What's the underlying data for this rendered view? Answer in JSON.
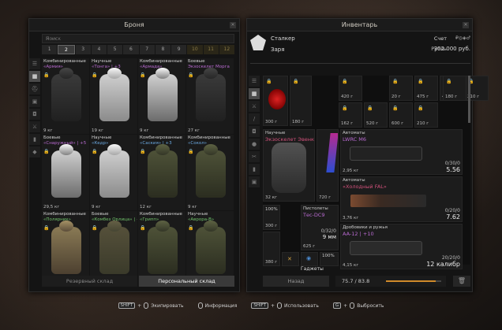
{
  "left_panel": {
    "title": "Броня",
    "search_placeholder": "Поиск",
    "search_controls": "✕  ‹  ›",
    "pages": [
      "1",
      "2",
      "3",
      "4",
      "5",
      "6",
      "7",
      "8",
      "9",
      "10",
      "11",
      "12"
    ],
    "active_page": "2",
    "sidebar_icons": [
      "list-icon",
      "grid-icon",
      "helmet-icon",
      "backpack-icon",
      "armor-icon",
      "weapon-icon",
      "ammo-icon",
      "artifact-icon"
    ],
    "items": [
      {
        "type": "Комбинированные",
        "name": "«Армия»",
        "name_color": "purple",
        "weight": "9 кг",
        "style": "dark"
      },
      {
        "type": "Научные",
        "name": "«Тонга» | +3",
        "name_color": "purple",
        "weight": "19 кг",
        "style": "white"
      },
      {
        "type": "Комбинированные",
        "name": "«Армада»",
        "name_color": "purple",
        "weight": "9 кг",
        "style": "whitecamo"
      },
      {
        "type": "Боевые",
        "name": "Экзоскелет Морга",
        "name_color": "purple",
        "weight": "27 кг",
        "style": "dark"
      },
      {
        "type": "Боевые",
        "name": "«Снаружный» | +5",
        "name_color": "purple",
        "weight": "29,5 кг",
        "style": "whitecamo"
      },
      {
        "type": "Научные",
        "name": "«Кедр»",
        "name_color": "blue",
        "weight": "9 кг",
        "style": "white"
      },
      {
        "type": "Комбинированные",
        "name": "«Саския» | +3",
        "name_color": "blue",
        "weight": "12 кг",
        "style": "olive"
      },
      {
        "type": "Комбинированные",
        "name": "«Сокол»",
        "name_color": "blue",
        "weight": "9 кг",
        "style": "olive"
      },
      {
        "type": "Комбинированные",
        "name": "«Полярник»",
        "name_color": "green",
        "weight": "",
        "style": "tan"
      },
      {
        "type": "Боевые",
        "name": "«Комбез Орлица» | +3",
        "name_color": "green",
        "weight": "",
        "style": "camo"
      },
      {
        "type": "Комбинированные",
        "name": "«Грипп»",
        "name_color": "green",
        "weight": "",
        "style": "olive"
      },
      {
        "type": "Научные",
        "name": "«Аврора-В»",
        "name_color": "green",
        "weight": "",
        "style": "olive"
      }
    ],
    "tabs": [
      "Резервный склад",
      "Персональный склад"
    ],
    "active_tab": "Персональный склад"
  },
  "right_panel": {
    "title": "Инвентарь",
    "role": "Сталкер",
    "faction": "Заря",
    "account_label": "Счет",
    "currency_label": "Рубль",
    "money": "302 000 руб.",
    "helmet": {
      "weight": "300 г"
    },
    "armor": {
      "type": "Научные",
      "name": "Экзоскелет Эвенка",
      "weight": "32 кг"
    },
    "artifact_slot": {
      "weight": "720 г"
    },
    "minis": [
      {
        "w": "420 г"
      },
      {
        "w": "180 г"
      },
      {
        "w": "20 г"
      },
      {
        "w": "475 г"
      },
      {
        "w": "440 г"
      },
      {
        "w": "210 г"
      },
      {
        "w": "180 г"
      },
      {
        "w": "162 г"
      },
      {
        "w": "520 г"
      },
      {
        "w": "600 г"
      },
      {
        "w": "210 г"
      }
    ],
    "weapons": [
      {
        "type": "Автоматы",
        "name": "LWRC M6",
        "name_color": "#b86ad0",
        "weight": "2,95 кг",
        "ammo": "0/30/0",
        "cal": "5.56",
        "style": "black"
      },
      {
        "type": "Автоматы",
        "name": "«Холодный FAL»",
        "name_color": "#d0507a",
        "weight": "3,76 кг",
        "ammo": "0/20/0",
        "cal": "7.62",
        "style": "wood"
      },
      {
        "type": "Дробовики и ружья",
        "name": "AA-12 | +10",
        "name_color": "#b86ad0",
        "weight": "4,15 кг",
        "ammo": "20/20/0",
        "cal": "12 калибр",
        "style": "shotgun"
      }
    ],
    "pistol": {
      "type": "Пистолеты",
      "name": "Тес-DC9",
      "ammo": "0/32/0",
      "cal": "9 мм",
      "weight": "625 г"
    },
    "gadgets_label": "Гаджеты",
    "small_items": [
      {
        "w": "300 г",
        "pct": "100%"
      },
      {
        "w": "380 г"
      },
      {
        "w": "100%"
      }
    ],
    "back_button": "Назад",
    "weight_value": "75.7 / 83.8",
    "weight_fraction": 0.9
  },
  "footer": [
    {
      "key": "SHIFT",
      "action": "Экипировать"
    },
    {
      "key": "",
      "action": "Информация"
    },
    {
      "key": "SHIFT",
      "action": "Использовать"
    },
    {
      "key": "G",
      "action": "Выбросить"
    }
  ]
}
